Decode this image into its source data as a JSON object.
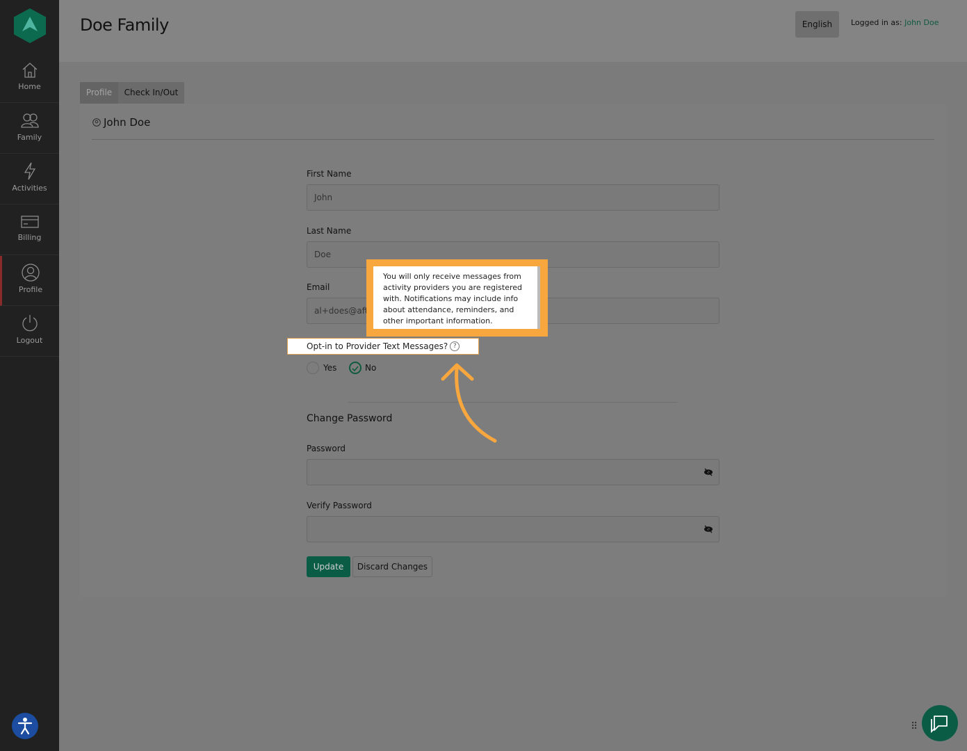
{
  "sidebar": {
    "items": [
      {
        "label": "Home",
        "icon": "home-icon"
      },
      {
        "label": "Family",
        "icon": "family-icon"
      },
      {
        "label": "Activities",
        "icon": "lightning-icon"
      },
      {
        "label": "Billing",
        "icon": "credit-card-icon"
      },
      {
        "label": "Profile",
        "icon": "user-circle-icon"
      },
      {
        "label": "Logout",
        "icon": "power-icon"
      }
    ],
    "active": "Profile"
  },
  "header": {
    "title": "Doe Family",
    "language_button": "English",
    "logged_in_prefix": "Logged in as:",
    "logged_in_user": "John Doe"
  },
  "tabs": [
    {
      "label": "Profile",
      "active": true
    },
    {
      "label": "Check In/Out",
      "active": false
    }
  ],
  "profile": {
    "card_title": "John Doe",
    "first_name_label": "First Name",
    "first_name_value": "John",
    "last_name_label": "Last Name",
    "last_name_value": "Doe",
    "email_label": "Email",
    "email_value": "al+does@aft",
    "opt_in_label": "Opt-in to Provider Text Messages?",
    "opt_in_yes": "Yes",
    "opt_in_no": "No",
    "opt_in_selected": "No",
    "tooltip_text": "You will only receive messages from activity providers you are registered with. Notifications may include info about attendance, reminders, and other important information.",
    "change_password_title": "Change Password",
    "password_label": "Password",
    "verify_password_label": "Verify Password",
    "update_button": "Update",
    "discard_button": "Discard Changes"
  },
  "colors": {
    "accent": "#0a5c45",
    "highlight": "#f7a73d",
    "sidebar": "#212121"
  }
}
